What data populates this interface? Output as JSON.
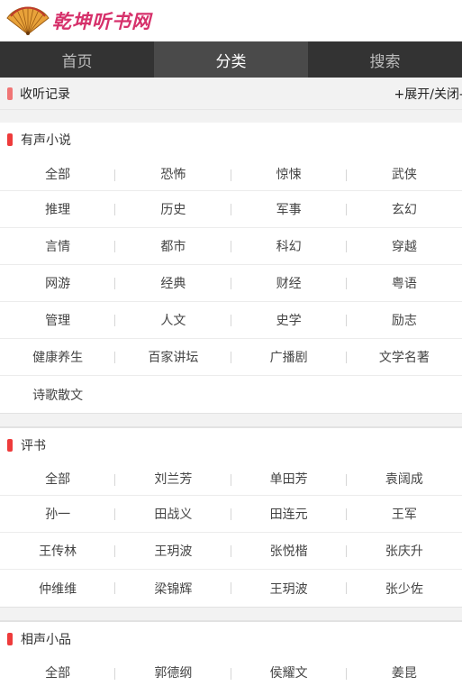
{
  "logo": {
    "text": "乾坤听书网"
  },
  "nav": {
    "tabs": [
      {
        "label": "首页",
        "active": false
      },
      {
        "label": "分类",
        "active": true
      },
      {
        "label": "搜索",
        "active": false
      }
    ]
  },
  "history": {
    "title": "收听记录",
    "toggle": "+展开/关闭-"
  },
  "sections": [
    {
      "title": "有声小说",
      "items": [
        "全部",
        "恐怖",
        "惊悚",
        "武侠",
        "推理",
        "历史",
        "军事",
        "玄幻",
        "言情",
        "都市",
        "科幻",
        "穿越",
        "网游",
        "经典",
        "财经",
        "粤语",
        "管理",
        "人文",
        "史学",
        "励志",
        "健康养生",
        "百家讲坛",
        "广播剧",
        "文学名著",
        "诗歌散文"
      ]
    },
    {
      "title": "评书",
      "items": [
        "全部",
        "刘兰芳",
        "单田芳",
        "袁阔成",
        "孙一",
        "田战义",
        "田连元",
        "王军",
        "王传林",
        "王玥波",
        "张悦楷",
        "张庆升",
        "仲维维",
        "梁锦辉",
        "王玥波",
        "张少佐"
      ]
    },
    {
      "title": "相声小品",
      "items": [
        "全部",
        "郭德纲",
        "侯耀文",
        "姜昆"
      ]
    }
  ],
  "colors": {
    "accent": "#ee3b3b",
    "nav_bg": "#333333",
    "logo": "#d6316b"
  }
}
